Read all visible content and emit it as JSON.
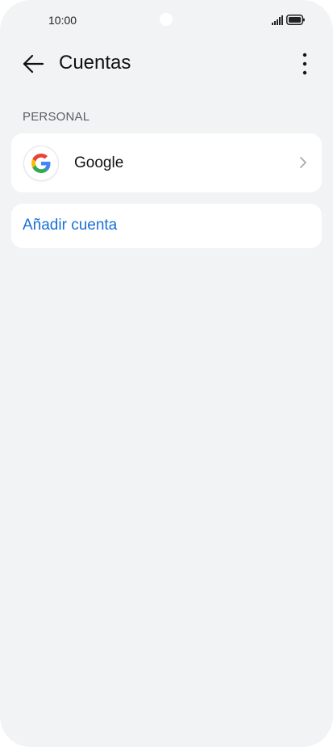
{
  "status_bar": {
    "time": "10:00",
    "icons": [
      "camera-cutout",
      "signal-icon",
      "battery-icon"
    ]
  },
  "header": {
    "title": "Cuentas",
    "back_icon": "arrow-left-icon",
    "menu_icon": "more-vertical-icon"
  },
  "section": {
    "label": "PERSONAL"
  },
  "accounts": [
    {
      "label": "Google",
      "icon": "google-logo-icon",
      "chevron": "chevron-right-icon"
    }
  ],
  "add_account": {
    "label": "Añadir cuenta"
  },
  "colors": {
    "background": "#f1f3f5",
    "card": "#ffffff",
    "accent": "#1a6fd6",
    "text": "#111111",
    "secondary_text": "#5b5e63"
  }
}
